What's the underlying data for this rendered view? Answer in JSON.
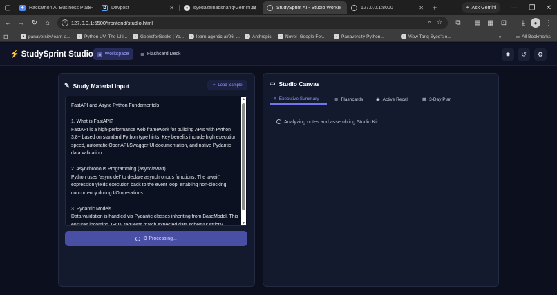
{
  "browser": {
    "tabs": [
      {
        "label": "Hackathon AI Business Plan -",
        "icon": "sparkle-icon",
        "color": "#4f8cf7"
      },
      {
        "label": "Devpost",
        "icon": "devpost-icon",
        "color": "#1f6feb"
      },
      {
        "label": "syedazainabshariq/Gemini30 -",
        "icon": "github-icon",
        "color": "#e6e6e6"
      },
      {
        "label": "StudySprint AI - Studio Works",
        "icon": "globe-icon",
        "color": "#cfcfcf"
      },
      {
        "label": "127.0.0.1:8000",
        "icon": "globe-icon",
        "color": "#cfcfcf"
      }
    ],
    "ask_gemini": "Ask Gemini",
    "url": "127.0.0.1:5500/frontend/studio.html",
    "bookmarks": [
      "panaversity/learn-a...",
      "Python UV: The Ulti...",
      "GeeksforGeeks | Yo...",
      "learn-agentic-ai/06_...",
      "Anthropic",
      "Novel- Google For...",
      "Panaversity-Python...",
      "View Tariq Syed's o..."
    ],
    "all_bookmarks": "All Bookmarks"
  },
  "app": {
    "brand": "StudySprint Studio",
    "nav": {
      "workspace": "Workspace",
      "flashcard_deck": "Flashcard Deck"
    },
    "input_panel": {
      "title": "Study Material Input",
      "load_sample": "Load Sample",
      "text": "FastAPI and Async Python Fundamentals\n\n1. What is FastAPI?\nFastAPI is a high-performance web framework for building APIs with Python 3.8+ based on standard Python type hints. Key benefits include high execution speed, automatic OpenAPI/Swagger UI documentation, and native Pydantic data validation.\n\n2. Asynchronous Programming (async/await)\nPython uses 'async def' to declare asynchronous functions. The 'await' expression yields execution back to the event loop, enabling non-blocking concurrency during I/O operations.\n\n3. Pydantic Models\nData validation is handled via Pydantic classes inheriting from BaseModel. This ensures incoming JSON requests match expected data schemas strictly.",
      "process_button": "⚙ Processing..."
    },
    "canvas": {
      "title": "Studio Canvas",
      "tabs": [
        "Executive Summary",
        "Flashcards",
        "Active Recall",
        "3-Day Plan"
      ],
      "status": "Analyzing notes and assembling Studio Kit..."
    }
  }
}
